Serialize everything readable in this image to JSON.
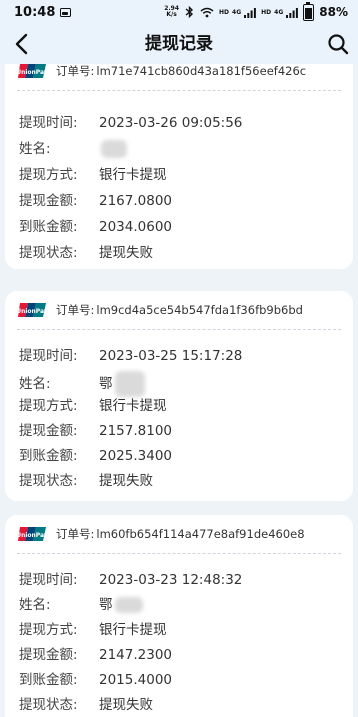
{
  "status_bar": {
    "time": "10:48",
    "net_speed_value": "2.94",
    "net_speed_unit": "K/s",
    "hd1": "HD",
    "sim1": "4G",
    "hd2": "HD",
    "sim2": "4G",
    "battery_percent": "88%",
    "battery_level": 0.88
  },
  "nav": {
    "title": "提现记录"
  },
  "labels": {
    "order": "订单号:",
    "time": "提现时间:",
    "name": "姓名:",
    "method": "提现方式:",
    "amount": "提现金额:",
    "received": "到账金额:",
    "status": "提现状态:"
  },
  "records": [
    {
      "order_no": "lm71e741cb860d43a181f56eef426c",
      "time": "2023-03-26 09:05:56",
      "name": "",
      "method": "银行卡提现",
      "amount": "2167.0800",
      "received": "2034.0600",
      "status": "提现失败"
    },
    {
      "order_no": "lm9cd4a5ce54b547fda1f36fb9b6bd",
      "time": "2023-03-25 15:17:28",
      "name": "鄂",
      "method": "银行卡提现",
      "amount": "2157.8100",
      "received": "2025.3400",
      "status": "提现失败"
    },
    {
      "order_no": "lm60fb654f114a477e8af91de460e8",
      "time": "2023-03-23 12:48:32",
      "name": "鄂",
      "method": "银行卡提现",
      "amount": "2147.2300",
      "received": "2015.4000",
      "status": "提现失败"
    }
  ],
  "colors": {
    "page_background": "#eef3f8",
    "card_background": "#ffffff",
    "unionpay_red": "#e21836",
    "unionpay_blue": "#00447c",
    "unionpay_teal": "#007b84"
  }
}
